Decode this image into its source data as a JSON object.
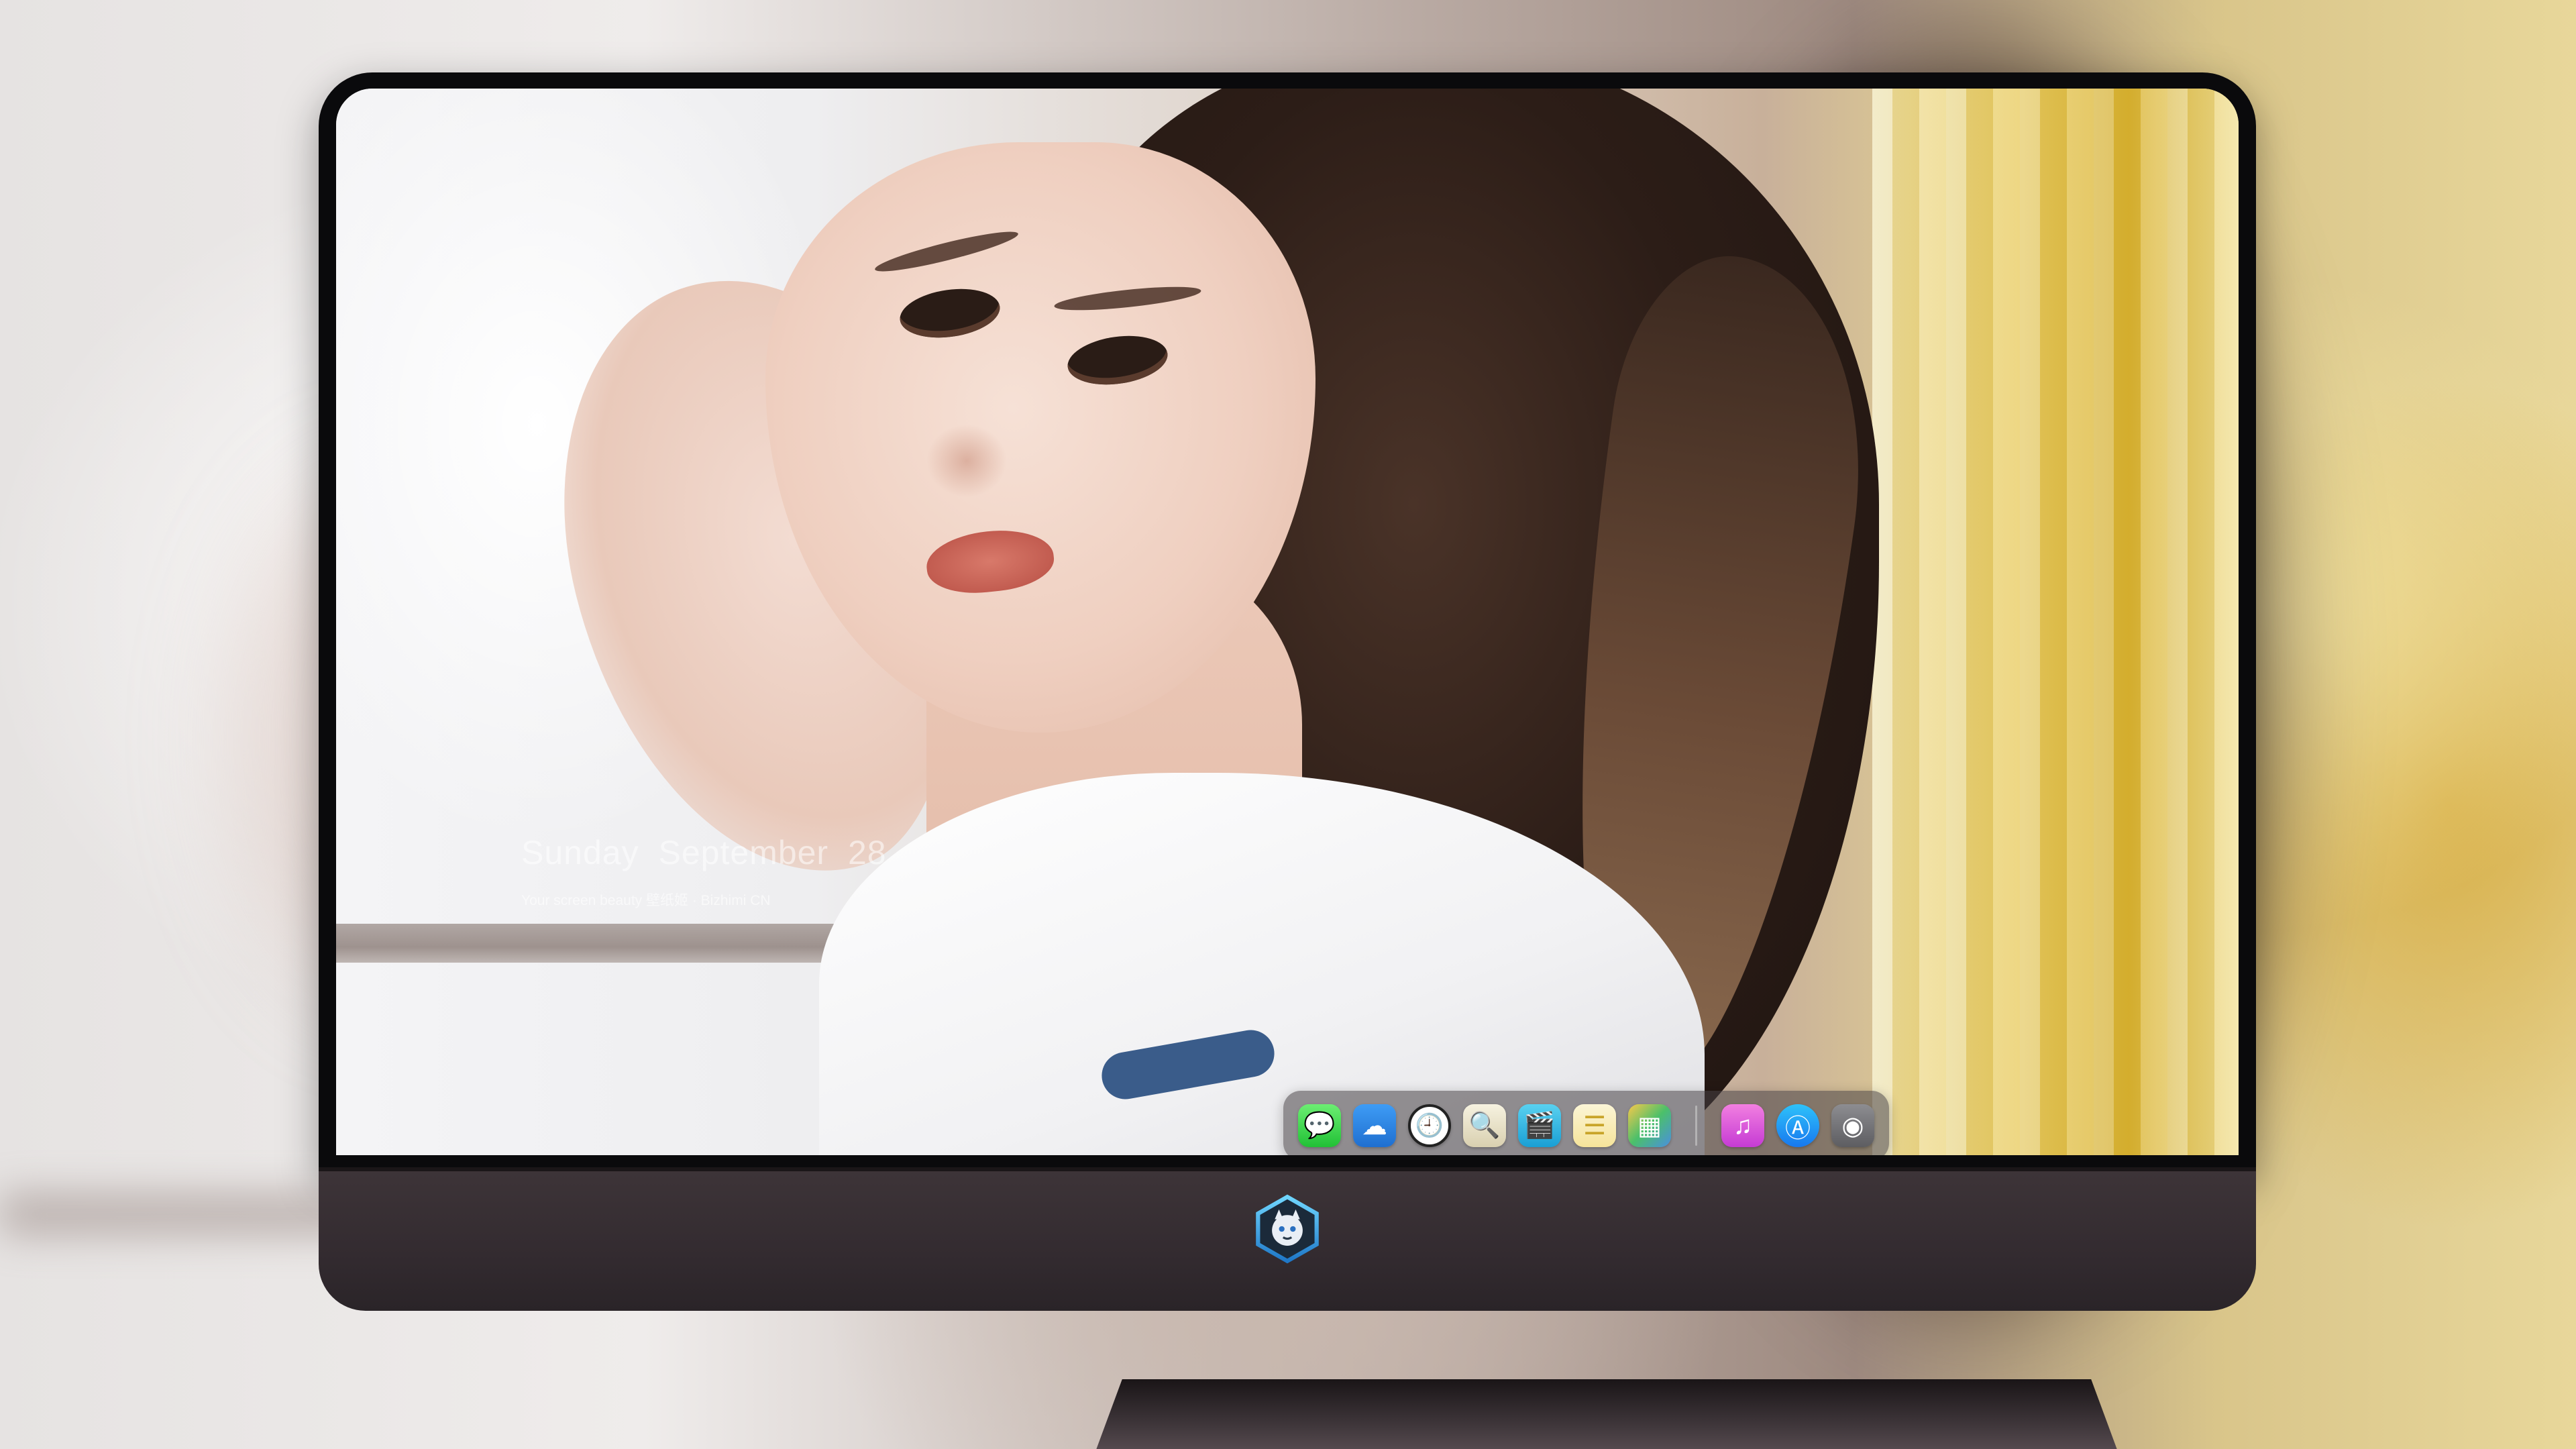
{
  "wallpaper": {
    "date": {
      "weekday": "Sunday",
      "month": "September",
      "day": "28"
    },
    "tagline": "Your screen beauty  壁纸姬 · Bizhimi CN"
  },
  "dock": {
    "apps": [
      {
        "id": "messages",
        "icon": "speech-bubble-icon",
        "glyph": "💬"
      },
      {
        "id": "weather",
        "icon": "cloud-icon",
        "glyph": "☁"
      },
      {
        "id": "clock",
        "icon": "clock-icon",
        "glyph": "🕘"
      },
      {
        "id": "preview",
        "icon": "preview-icon",
        "glyph": "🔍"
      },
      {
        "id": "clips",
        "icon": "clapperboard-icon",
        "glyph": "🎬"
      },
      {
        "id": "notes",
        "icon": "notes-icon",
        "glyph": "☰"
      },
      {
        "id": "photos",
        "icon": "photos-icon",
        "glyph": "▦"
      },
      {
        "id": "music",
        "icon": "music-note-icon",
        "glyph": "♫"
      },
      {
        "id": "appstore",
        "icon": "app-store-icon",
        "glyph": "Ⓐ"
      },
      {
        "id": "camera",
        "icon": "camera-icon",
        "glyph": "◉"
      }
    ]
  },
  "colors": {
    "bezel": "#0a0a0c",
    "chin": "#3d3438",
    "dock_bg": "rgba(70,64,68,0.55)"
  }
}
